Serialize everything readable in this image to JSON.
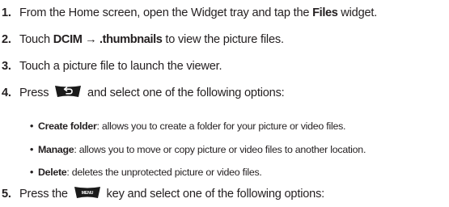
{
  "steps": [
    {
      "number": "1.",
      "pre": "From the Home screen, open the Widget tray and tap the ",
      "bold": "Files",
      "post": " widget."
    },
    {
      "number": "2.",
      "pre": "Touch ",
      "bold": "DCIM → .thumbnails",
      "post": " to view the picture files."
    },
    {
      "number": "3.",
      "text": "Touch a picture file to launch the viewer."
    },
    {
      "number": "4.",
      "pre": "Press ",
      "icon": "back-key-icon",
      "post": " and select one of the following options:"
    },
    {
      "number": "5.",
      "pre": "Press the ",
      "icon": "menu-key-icon",
      "icon_label": "MENU",
      "post": " key and select one of the following options:"
    }
  ],
  "bullets": [
    {
      "dot": "•",
      "term": "Create folder",
      "desc": ": allows you to create a folder for your picture or video files."
    },
    {
      "dot": "•",
      "term": "Manage",
      "desc": ": allows you to move or copy picture or video files to another location."
    },
    {
      "dot": "•",
      "term": "Delete",
      "desc": ": deletes the unprotected picture or video files."
    }
  ],
  "colors": {
    "text": "#231f20",
    "key_bg": "#1a1a1a",
    "key_fg": "#ffffff"
  }
}
